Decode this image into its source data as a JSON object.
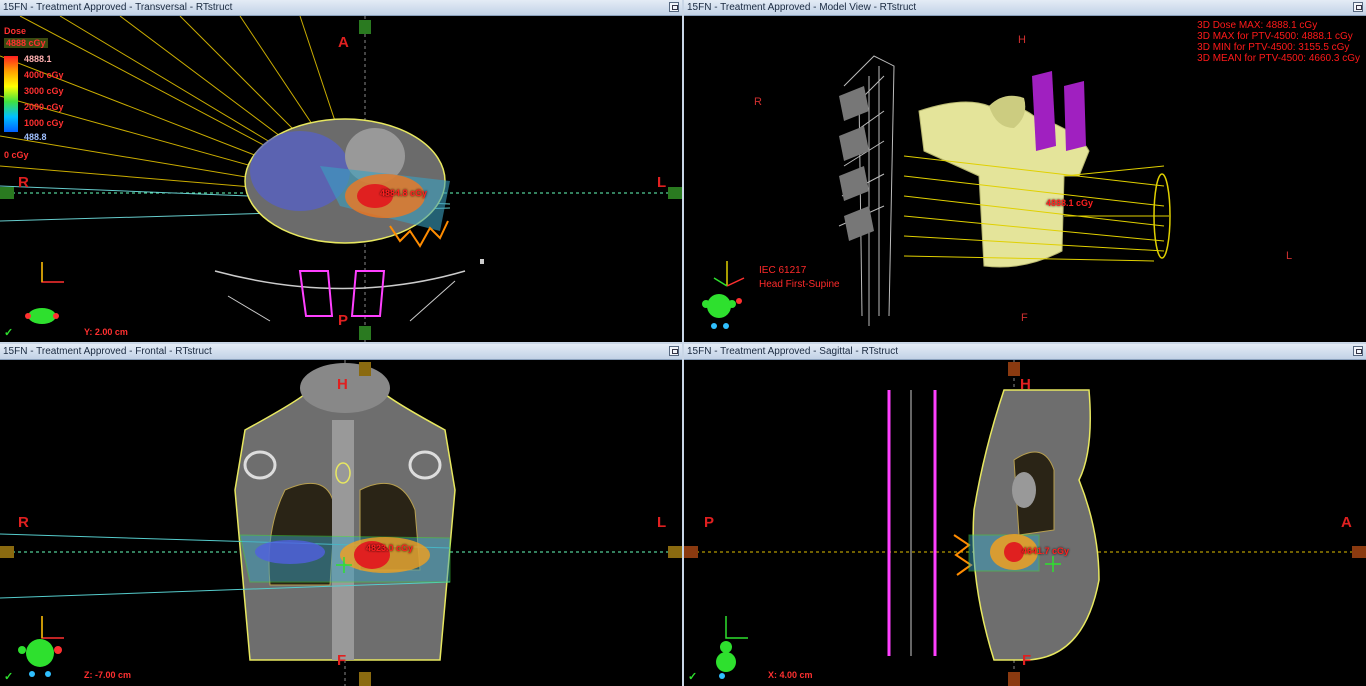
{
  "panes": {
    "transversal": {
      "title": "15FN  -  Treatment Approved - Transversal - RTstruct",
      "orient_top": "A",
      "orient_bottom": "P",
      "orient_left": "R",
      "orient_right": "L",
      "coord": "Y: 2.00 cm",
      "dose_point": "4884.8 cGy",
      "legend": {
        "title": "Dose",
        "max_box": "4888 cGy",
        "upper": "4888.1",
        "levels": [
          "4000 cGy",
          "3000 cGy",
          "2000 cGy",
          "1000 cGy"
        ],
        "lower": "488.8",
        "min_box": "0 cGy"
      }
    },
    "model": {
      "title": "15FN  -  Treatment Approved - Model View - RTstruct",
      "orient_top": "H",
      "orient_bottom": "F",
      "orient_left": "R",
      "orient_right": "L",
      "stats": [
        "3D Dose MAX: 4888.1 cGy",
        "3D MAX for PTV-4500: 4888.1 cGy",
        "3D MIN for PTV-4500: 3155.5 cGy",
        "3D MEAN for PTV-4500: 4660.3 cGy"
      ],
      "dose_point": "4888.1 cGy",
      "iec_line1": "IEC 61217",
      "iec_line2": "Head First-Supine"
    },
    "frontal": {
      "title": "15FN  -  Treatment Approved - Frontal - RTstruct",
      "orient_top": "H",
      "orient_bottom": "F",
      "orient_left": "R",
      "orient_right": "L",
      "coord": "Z: -7.00 cm",
      "dose_point": "4823.0 cGy"
    },
    "sagittal": {
      "title": "15FN  -  Treatment Approved - Sagittal - RTstruct",
      "orient_top": "H",
      "orient_bottom": "F",
      "orient_left": "P",
      "orient_right": "A",
      "coord": "X: 4.00 cm",
      "dose_point": "4641.7 cGy"
    }
  },
  "check_mark": "✓",
  "colors": {
    "accent_red": "#ff2020",
    "beam_yellow": "#e6c200",
    "ptv_green": "#2ee02e",
    "body_yellow": "#e8e8a0"
  }
}
